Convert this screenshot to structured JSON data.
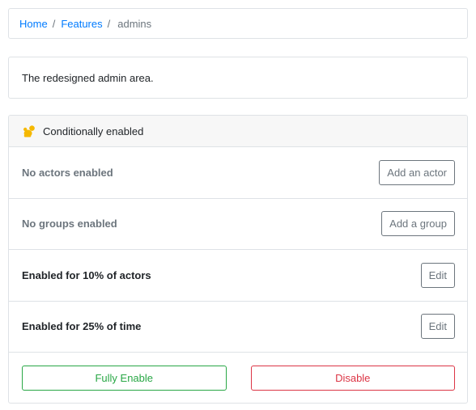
{
  "breadcrumb": {
    "items": [
      {
        "label": "Home"
      },
      {
        "label": "Features"
      }
    ],
    "separator": "/",
    "active": "admins"
  },
  "feature": {
    "description": "The redesigned admin area."
  },
  "gate": {
    "status_title": "Conditionally enabled",
    "status_icon": "squirrel-icon",
    "status_color": "#f5b800",
    "rows": [
      {
        "label": "No actors enabled",
        "button": "Add an actor"
      },
      {
        "label": "No groups enabled",
        "button": "Add a group"
      },
      {
        "label": "Enabled for 10% of actors",
        "button": "Edit"
      },
      {
        "label": "Enabled for 25% of time",
        "button": "Edit"
      }
    ],
    "fully_enable_label": "Fully Enable",
    "disable_label": "Disable"
  },
  "colors": {
    "link": "#007bff",
    "success": "#28a745",
    "danger": "#dc3545",
    "muted": "#6c757d"
  }
}
